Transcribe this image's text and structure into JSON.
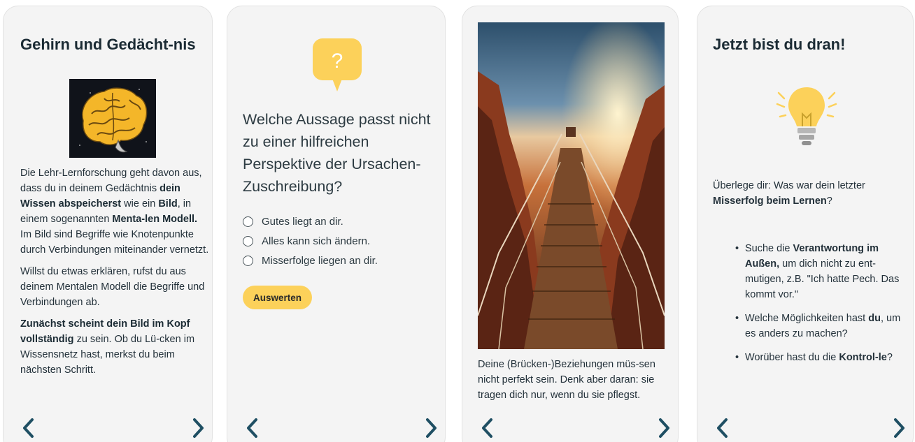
{
  "card1": {
    "title": "Gehirn und Gedächt-nis",
    "image_icon": "brain-illustration",
    "paragraphs": [
      {
        "pre": "Die Lehr-Lernforschung geht davon aus, dass du in deinem Gedächtnis ",
        "b1": "dein Wissen abspeicherst",
        "mid1": " wie ein ",
        "b2": "Bild",
        "mid2": ", in einem sogenannten ",
        "b3": "Menta-len Modell.",
        "post": " Im Bild sind Begriffe wie Knotenpunkte durch Verbindungen miteinander vernetzt."
      },
      {
        "text": "Willst du etwas erklären, rufst du aus deinem Mentalen Modell die Begriffe und Verbindungen ab."
      },
      {
        "b1": "Zunächst scheint dein Bild im Kopf vollständig",
        "post": " zu sein. Ob du Lü-cken im Wissensnetz hast, merkst du beim nächsten Schritt."
      }
    ],
    "nav_prev_icon": "chevron-left-icon",
    "nav_next_icon": "chevron-right-icon"
  },
  "card2": {
    "icon": "question-bubble-icon",
    "icon_glyph": "?",
    "question": "Welche Aussage passt nicht zu einer hilfreichen Perspektive der Ursachen-Zuschreibung?",
    "options": [
      "Gutes liegt an dir.",
      "Alles kann sich ändern.",
      "Misserfolge liegen an dir."
    ],
    "button_label": "Auswerten"
  },
  "card3": {
    "image_icon": "bridge-canyon-photo",
    "text": "Deine (Brücken-)Beziehungen müs-sen nicht perfekt sein. Denk aber daran: sie tragen dich nur, wenn du sie pflegst."
  },
  "card4": {
    "title": "Jetzt bist du dran!",
    "icon": "lightbulb-icon",
    "intro_pre": "Überlege dir: Was war dein letzter ",
    "intro_bold": "Misserfolg beim Lernen",
    "intro_post": "?",
    "bullets": [
      {
        "pre": "Suche die ",
        "bold": "Verantwortung im Außen,",
        "post": " um dich nicht zu ent-mutigen, z.B. \"Ich hatte Pech. Das kommt vor.\""
      },
      {
        "pre": "Welche Möglichkeiten hast ",
        "bold": "du",
        "post": ", um es anders zu machen?"
      },
      {
        "pre": "Worüber hast du die ",
        "bold": "Kontrol-le",
        "post": "?"
      }
    ]
  },
  "colors": {
    "accent_yellow": "#fcd15a",
    "nav_arrow": "#1f4f63",
    "card_bg": "#f4f4f4",
    "text_dark": "#1b2b34"
  }
}
